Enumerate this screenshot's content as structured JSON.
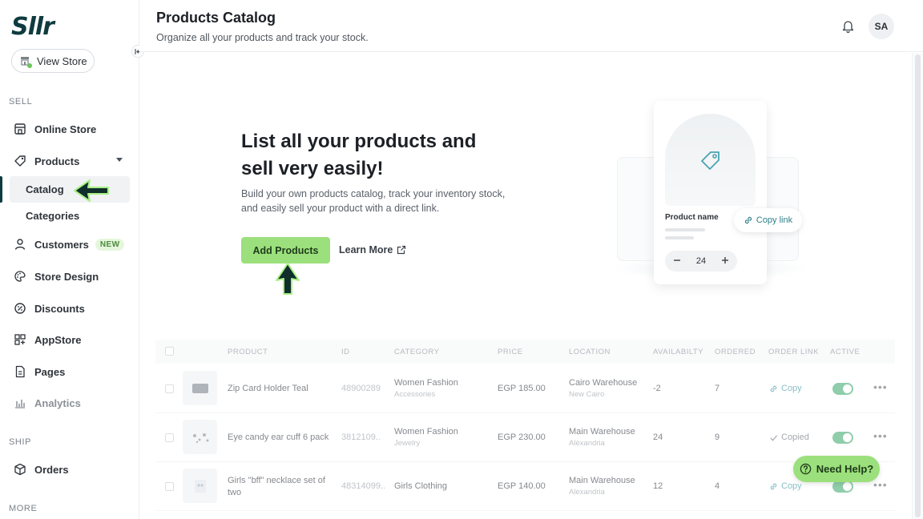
{
  "app": {
    "logo_text": "Sllr"
  },
  "sidebar": {
    "view_store": "View Store",
    "sections": {
      "sell": "SELL",
      "ship": "SHIP",
      "more": "MORE"
    },
    "items": {
      "online_store": "Online Store",
      "products": "Products",
      "catalog": "Catalog",
      "categories": "Categories",
      "customers": "Customers",
      "customers_badge": "NEW",
      "store_design": "Store Design",
      "discounts": "Discounts",
      "appstore": "AppStore",
      "pages": "Pages",
      "analytics": "Analytics",
      "orders": "Orders"
    }
  },
  "header": {
    "title": "Products Catalog",
    "subtitle": "Organize all your products and track your stock.",
    "avatar_initials": "SA"
  },
  "hero": {
    "title": "List all your products and sell very easily!",
    "description": "Build your own products catalog, track your inventory stock, and easily sell your product with a direct link.",
    "add_button": "Add Products",
    "learn_more": "Learn More"
  },
  "illustration": {
    "product_name": "Product name",
    "quantity": "24",
    "copy_link": "Copy link"
  },
  "table": {
    "headers": {
      "product": "PRODUCT",
      "id": "ID",
      "category": "CATEGORY",
      "price": "PRICE",
      "location": "LOCATION",
      "availability": "AVAILABILTY",
      "ordered": "ORDERED",
      "order_link": "ORDER LINK",
      "active": "ACTIVE"
    },
    "rows": [
      {
        "name": "Zip Card Holder Teal",
        "id": "48900289",
        "category": "Women Fashion",
        "subcategory": "Accessories",
        "price": "EGP 185.00",
        "location": "Cairo Warehouse",
        "sublocation": "New Cairo",
        "availability": "-2",
        "ordered": "7",
        "link": "Copy"
      },
      {
        "name": "Eye candy ear cuff 6 pack",
        "id": "3812109..",
        "category": "Women Fashion",
        "subcategory": "Jewelry",
        "price": "EGP 230.00",
        "location": "Main Warehouse",
        "sublocation": "Alexandria",
        "availability": "24",
        "ordered": "9",
        "link": "Copied"
      },
      {
        "name": "Girls \"bff\" necklace set of two",
        "id": "48314099..",
        "category": "Girls Clothing",
        "subcategory": "",
        "price": "EGP 140.00",
        "location": "Main Warehouse",
        "sublocation": "Alexandria",
        "availability": "12",
        "ordered": "4",
        "link": "Copy"
      }
    ]
  },
  "help": {
    "label": "Need Help?"
  },
  "colors": {
    "accent_green": "#9be07c",
    "brand_dark": "#0e3b3f",
    "link_teal": "#3f97a5",
    "toggle_green": "#4caf79"
  }
}
